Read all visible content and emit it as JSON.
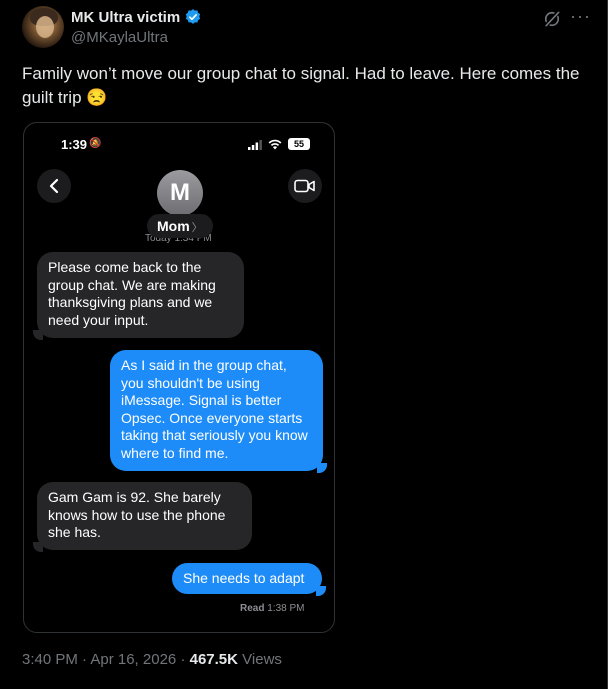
{
  "post": {
    "author": {
      "display_name": "MK Ultra victim",
      "handle": "@MKaylaUltra",
      "verified_icon": "verified-badge-icon"
    },
    "text": "Family won’t move our group chat to signal. Had to leave. Here comes the guilt trip 😒",
    "timestamp": "3:40 PM · Apr 16, 2026",
    "separator": "·",
    "views_count": "467.5K",
    "views_label": "Views"
  },
  "screenshot": {
    "status_bar": {
      "time": "1:39",
      "battery": "55"
    },
    "contact": {
      "initial": "M",
      "name": "Mom",
      "today_label": "Today 1:34 PM"
    },
    "messages": [
      {
        "from": "them",
        "text": "Please come back to the group chat. We are making thanksgiving plans and we need your input."
      },
      {
        "from": "me",
        "text": "As I said in the group chat, you shouldn't be using iMessage. Signal is better Opsec. Once everyone starts taking that seriously you know where to find me."
      },
      {
        "from": "them",
        "text": "Gam Gam is 92. She barely knows how to use the phone she has."
      },
      {
        "from": "me",
        "text": "She needs to adapt"
      }
    ],
    "read_receipt": {
      "label": "Read",
      "time": "1:38 PM"
    }
  },
  "colors": {
    "background": "#000000",
    "sent_bubble": "#1d8cf8",
    "received_bubble": "#262628",
    "muted_text": "#71767b",
    "verified_blue": "#1d9bf0"
  }
}
